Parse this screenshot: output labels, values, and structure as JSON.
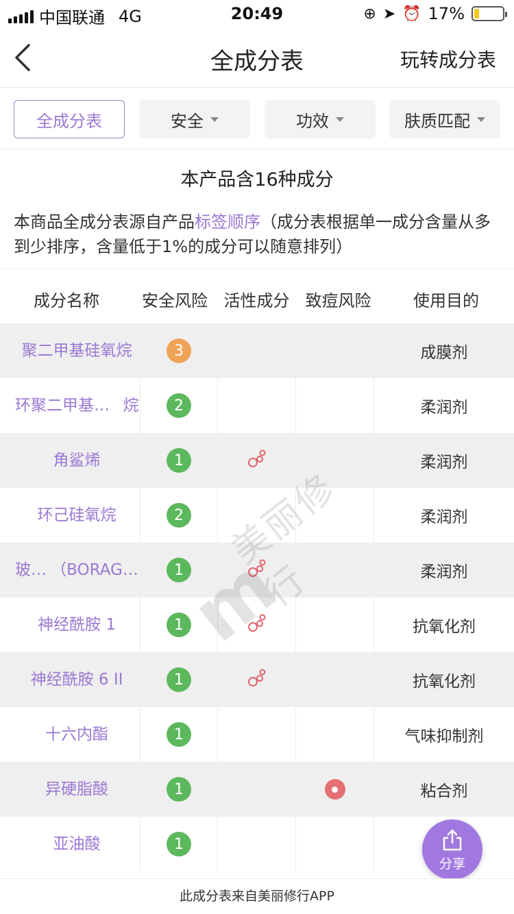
{
  "status_bar": {
    "carrier": "中国联通",
    "network": "4G",
    "time": "20:49",
    "battery": "17%",
    "battery_level": 0.17
  },
  "nav": {
    "title": "全成分表",
    "right_label": "玩转成分表",
    "back_icon": "chevron-left-icon"
  },
  "tabs": [
    {
      "label": "全成分表",
      "active": true,
      "has_caret": false
    },
    {
      "label": "安全",
      "active": false,
      "has_caret": true
    },
    {
      "label": "功效",
      "active": false,
      "has_caret": true
    },
    {
      "label": "肤质匹配",
      "active": false,
      "has_caret": true
    }
  ],
  "summary": {
    "count_title": "本产品含16种成分",
    "desc_prefix": "本商品全成分表源自产品",
    "desc_link": "标签顺序",
    "desc_suffix": "（成分表根据单一成分含量从多到少排序，含量低于1%的成分可以随意排列）"
  },
  "table": {
    "headers": [
      "成分名称",
      "安全风险",
      "活性成分",
      "致痘风险",
      "使用目的"
    ],
    "rows": [
      {
        "name": [
          "聚二甲基硅氧烷"
        ],
        "risk": 3,
        "active": false,
        "acne": false,
        "purpose": "成膜剂"
      },
      {
        "name": [
          "环聚二甲基硅氧",
          "烷"
        ],
        "risk": 2,
        "active": false,
        "acne": false,
        "purpose": "柔润剂"
      },
      {
        "name": [
          "角鲨烯"
        ],
        "risk": 1,
        "active": true,
        "acne": false,
        "purpose": "柔润剂"
      },
      {
        "name": [
          "环己硅氧烷"
        ],
        "risk": 2,
        "active": false,
        "acne": false,
        "purpose": "柔润剂"
      },
      {
        "name": [
          "玻璃苣",
          "（BORAGO O..."
        ],
        "risk": 1,
        "active": true,
        "acne": false,
        "purpose": "柔润剂"
      },
      {
        "name": [
          "神经酰胺 1"
        ],
        "risk": 1,
        "active": true,
        "acne": false,
        "purpose": "抗氧化剂"
      },
      {
        "name": [
          "神经酰胺 6 II"
        ],
        "risk": 1,
        "active": true,
        "acne": false,
        "purpose": "抗氧化剂"
      },
      {
        "name": [
          "十六内酯"
        ],
        "risk": 1,
        "active": false,
        "acne": false,
        "purpose": "气味抑制剂"
      },
      {
        "name": [
          "异硬脂酸"
        ],
        "risk": 1,
        "active": false,
        "acne": true,
        "purpose": "粘合剂"
      },
      {
        "name": [
          "亚油酸"
        ],
        "risk": 1,
        "active": false,
        "acne": false,
        "purpose": ""
      }
    ]
  },
  "colors": {
    "accent": "#9a78d3",
    "risk_low": "#5cb85c",
    "risk_mid": "#f0a458",
    "acne": "#e66f73",
    "active_icon": "#e0646c",
    "fab": "#a178e0"
  },
  "watermark": "美丽修行",
  "share": {
    "label": "分享",
    "icon": "share-icon"
  },
  "footer": {
    "text": "此成分表来自美丽修行APP"
  }
}
